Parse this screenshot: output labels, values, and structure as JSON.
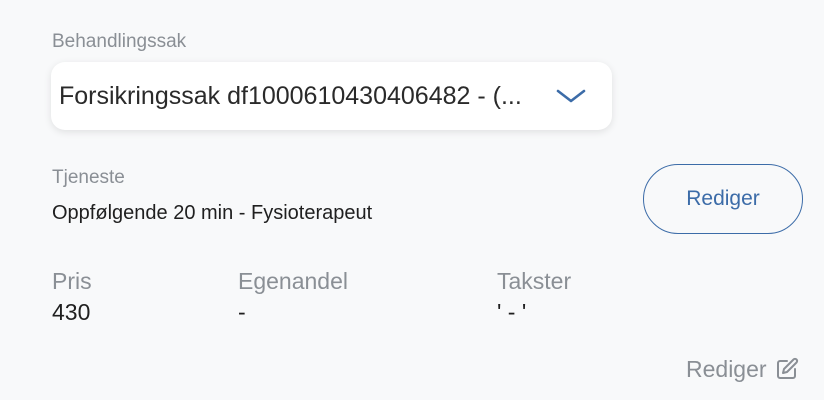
{
  "case": {
    "label": "Behandlingssak",
    "selected": "Forsikringssak df1000610430406482 - (..."
  },
  "service": {
    "label": "Tjeneste",
    "value": "Oppfølgende 20 min - Fysioterapeut",
    "edit_label": "Rediger"
  },
  "fields": {
    "price_label": "Pris",
    "price_value": "430",
    "copay_label": "Egenandel",
    "copay_value": "-",
    "rates_label": "Takster",
    "rates_value": "' - '"
  },
  "footer": {
    "edit_label": "Rediger",
    "edit_icon": "pencil-square-icon"
  },
  "colors": {
    "accent": "#3c6ca8",
    "muted": "#8a8f95",
    "background": "#f8f9fa"
  }
}
